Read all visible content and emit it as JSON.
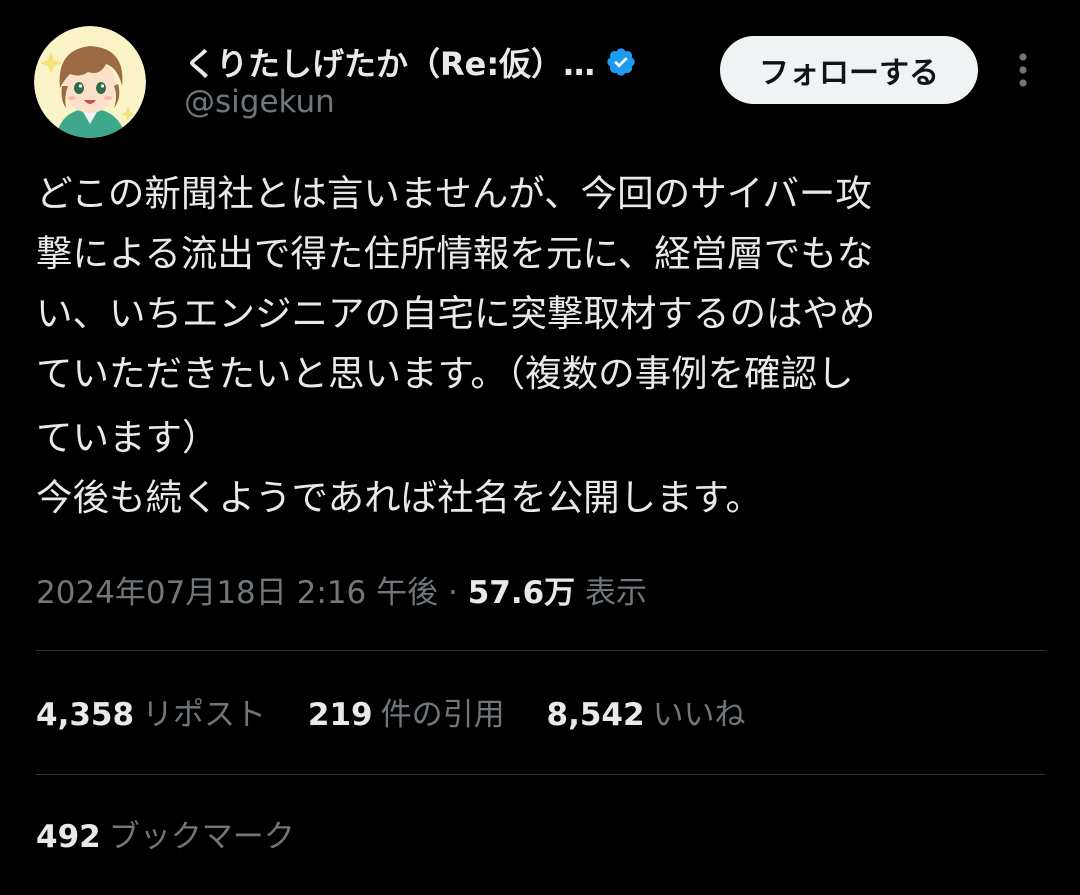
{
  "author": {
    "display_name": "くりたしげたか（Re:仮）…",
    "handle": "@sigekun",
    "avatar_icon": "user-avatar-icon",
    "verified_icon": "verified-badge-icon",
    "verified_color": "#1d9bf0"
  },
  "actions": {
    "follow_label": "フォローする",
    "more_icon": "more-vertical-icon"
  },
  "tweet": {
    "lines": [
      "どこの新聞社とは言いませんが、今回のサイバー攻",
      "撃による流出で得た住所情報を元に、経営層でもな",
      "い、いちエンジニアの自宅に突撃取材するのはやめ",
      "ていただきたいと思います。（複数の事例を確認し",
      "ています）",
      "今後も続くようであれば社名を公開します。"
    ]
  },
  "meta": {
    "timestamp": "2024年07月18日 2:16 午後",
    "separator": "·",
    "views_count": "57.6万",
    "views_label": "表示"
  },
  "stats": {
    "reposts_count": "4,358",
    "reposts_label": "リポスト",
    "quotes_count": "219",
    "quotes_label": "件の引用",
    "likes_count": "8,542",
    "likes_label": "いいね",
    "bookmarks_count": "492",
    "bookmarks_label": "ブックマーク"
  },
  "colors": {
    "background": "#000000",
    "primary_text": "#e7e9ea",
    "secondary_text": "#71767b",
    "divider": "#2f3336",
    "follow_button_bg": "#eff3f4"
  }
}
